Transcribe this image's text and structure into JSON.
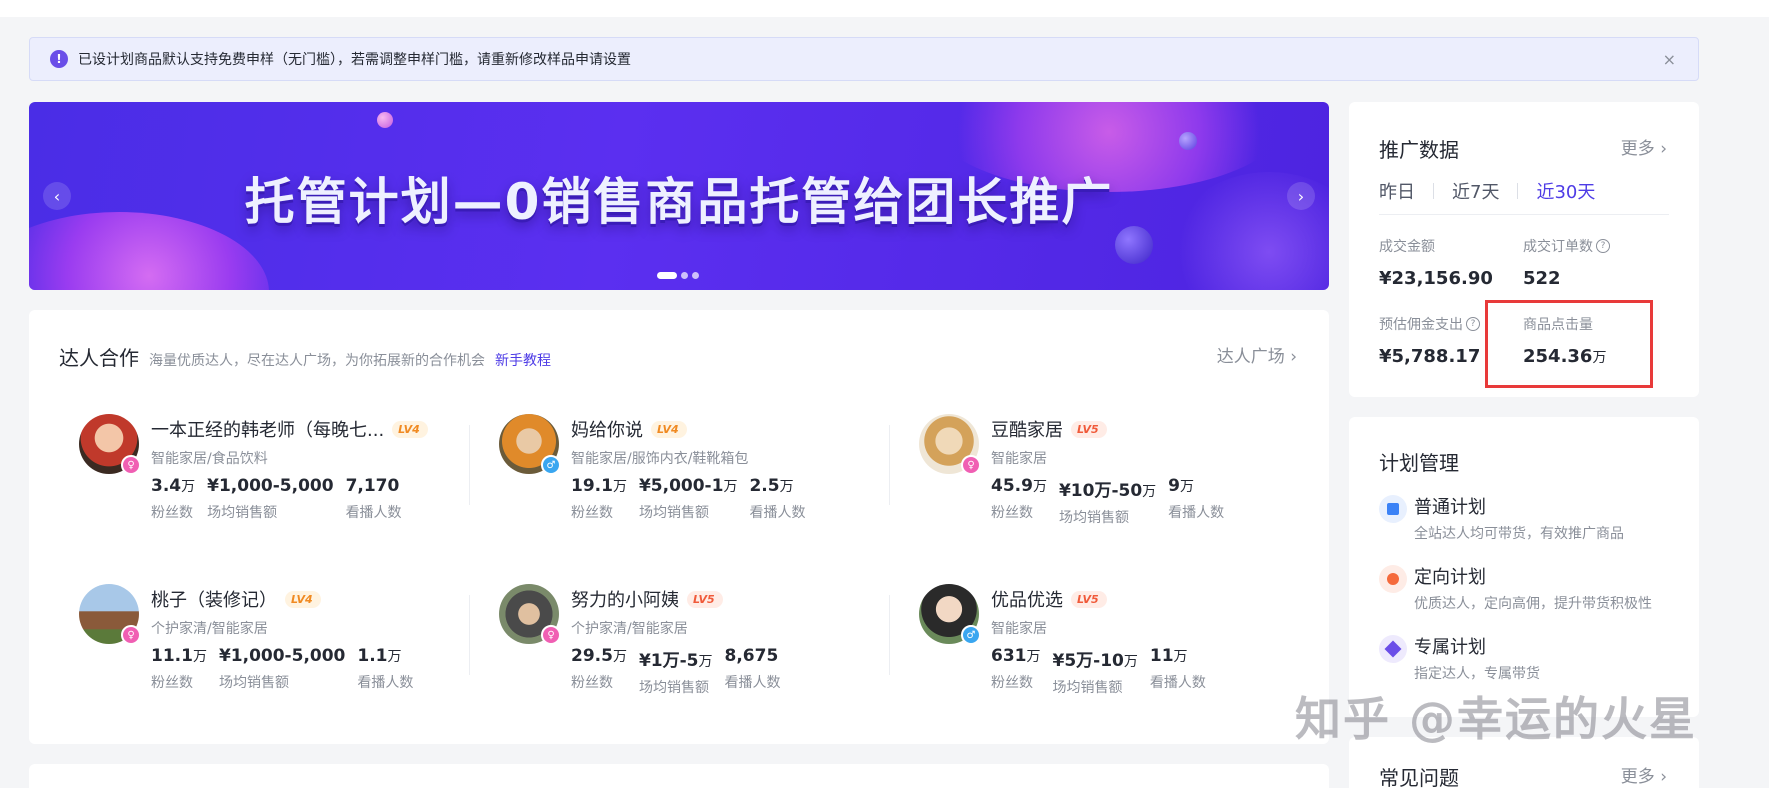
{
  "notice": {
    "text": "已设计划商品默认支持免费申样（无门槛），若需调整申样门槛，请重新修改样品申请设置",
    "icon": "info-icon",
    "close": "×"
  },
  "banner": {
    "headline": "托管计划—0销售商品托管给团长推广",
    "prev": "‹",
    "next": "›",
    "slide_count": 3,
    "active_slide": 1
  },
  "talent": {
    "title": "达人合作",
    "subtitle": "海量优质达人，尽在达人广场，为你拓展新的合作机会",
    "tutorial": "新手教程",
    "more": "达人广场 ›",
    "list": [
      {
        "name": "一本正经的韩老师（每晚七...",
        "level": "LV4",
        "category": "智能家居/食品饮料",
        "fans": "3.4",
        "fans_unit": "万",
        "sales": "¥1,000-5,000",
        "viewers": "7,170",
        "viewers_unit": "",
        "gender": "female"
      },
      {
        "name": "妈给你说",
        "level": "LV4",
        "category": "智能家居/服饰内衣/鞋靴箱包",
        "fans": "19.1",
        "fans_unit": "万",
        "sales": "¥5,000-1",
        "sales_unit": "万",
        "viewers": "2.5",
        "viewers_unit": "万",
        "gender": "male"
      },
      {
        "name": "豆酷家居",
        "level": "LV5",
        "category": "智能家居",
        "fans": "45.9",
        "fans_unit": "万",
        "sales": "¥10万-50",
        "sales_unit": "万",
        "viewers": "9",
        "viewers_unit": "万",
        "gender": "female"
      },
      {
        "name": "桃子（装修记）",
        "level": "LV4",
        "category": "个护家清/智能家居",
        "fans": "11.1",
        "fans_unit": "万",
        "sales": "¥1,000-5,000",
        "viewers": "1.1",
        "viewers_unit": "万",
        "gender": "female"
      },
      {
        "name": "努力的小阿姨",
        "level": "LV5",
        "category": "个护家清/智能家居",
        "fans": "29.5",
        "fans_unit": "万",
        "sales": "¥1万-5",
        "sales_unit": "万",
        "viewers": "8,675",
        "viewers_unit": "",
        "gender": "female"
      },
      {
        "name": "优品优选",
        "level": "LV5",
        "category": "智能家居",
        "fans": "631",
        "fans_unit": "万",
        "sales": "¥5万-10",
        "sales_unit": "万",
        "viewers": "11",
        "viewers_unit": "万",
        "gender": "male"
      }
    ],
    "labels": {
      "fans": "粉丝数",
      "sales": "场均销售额",
      "viewers": "看播人数"
    }
  },
  "promo": {
    "title": "推广数据",
    "more": "更多 ›",
    "tabs": [
      "昨日",
      "近7天",
      "近30天"
    ],
    "active_tab": 2,
    "metrics": {
      "gmv": {
        "label": "成交金额",
        "value": "¥23,156.90"
      },
      "orders": {
        "label": "成交订单数",
        "value": "522"
      },
      "commission": {
        "label": "预估佣金支出",
        "value": "¥5,788.17"
      },
      "clicks": {
        "label": "商品点击量",
        "value": "254.36",
        "unit": "万"
      }
    },
    "help_glyph": "?",
    "highlight_color": "#e83a3a"
  },
  "plan": {
    "title": "计划管理",
    "items": [
      {
        "name": "普通计划",
        "desc": "全站达人均可带货，有效推广商品",
        "icon": "bag-icon",
        "color": "#3b82f6",
        "bg": "#e8f0fe"
      },
      {
        "name": "定向计划",
        "desc": "优质达人，定向高佣，提升带货积极性",
        "icon": "target-icon",
        "color": "#f56a3c",
        "bg": "#feece6"
      },
      {
        "name": "专属计划",
        "desc": "指定达人，专属带货",
        "icon": "diamond-icon",
        "color": "#6b4ee8",
        "bg": "#eeeafd"
      }
    ]
  },
  "faq": {
    "title": "常见问题",
    "more": "更多 ›"
  },
  "watermark": "知乎 @幸运的火星",
  "colors": {
    "accent": "#4e3ce6",
    "banner": "#5b2ff0"
  }
}
